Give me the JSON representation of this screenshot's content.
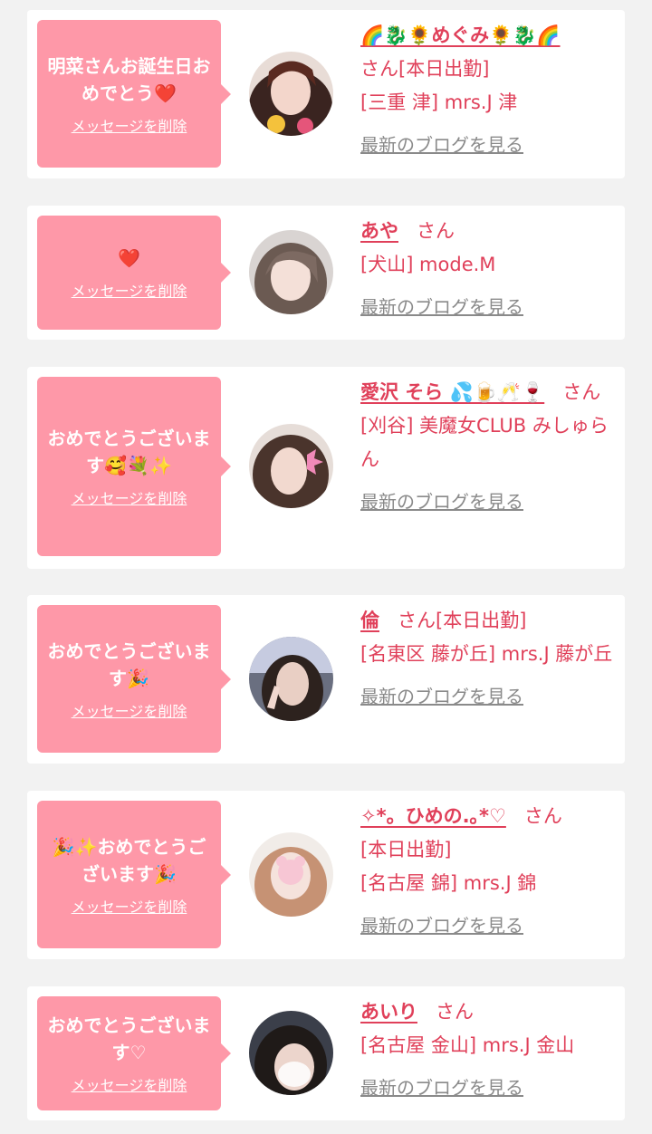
{
  "colors": {
    "bubble": "#fe98a8",
    "accent": "#e0405a",
    "link_gray": "#8a8a8a",
    "background": "#f2f2f2"
  },
  "delete_label": "メッセージを削除",
  "blog_label": "最新のブログを見る",
  "cards": [
    {
      "message": "明菜さんお誕生日おめでとう❤️",
      "name": "🌈🐉🌻めぐみ🌻🐉🌈",
      "san": "",
      "status": "さん[本日出勤]",
      "shop": "[三重 津] mrs.J 津"
    },
    {
      "message": "❤️",
      "name": "あや",
      "san": "さん",
      "status": "",
      "shop": "[犬山] mode.M"
    },
    {
      "message": "おめでとうございます🥰💐✨",
      "name": "愛沢 そら 💦🍺🥂🍷",
      "san": "さん",
      "status": "",
      "shop": "[刈谷] 美魔女CLUB みしゅらん"
    },
    {
      "message": "おめでとうございます🎉",
      "name": "倫",
      "san": "さん[本日出勤]",
      "status": "",
      "shop": "[名東区 藤が丘] mrs.J 藤が丘"
    },
    {
      "message": "🎉✨おめでとうございます🎉",
      "name": "✧*。ひめの.｡*♡",
      "san": "さん",
      "status": "[本日出勤]",
      "shop": "[名古屋 錦] mrs.J 錦"
    },
    {
      "message": "おめでとうございます♡",
      "name": "あいり",
      "san": "さん",
      "status": "",
      "shop": "[名古屋 金山] mrs.J 金山"
    }
  ]
}
